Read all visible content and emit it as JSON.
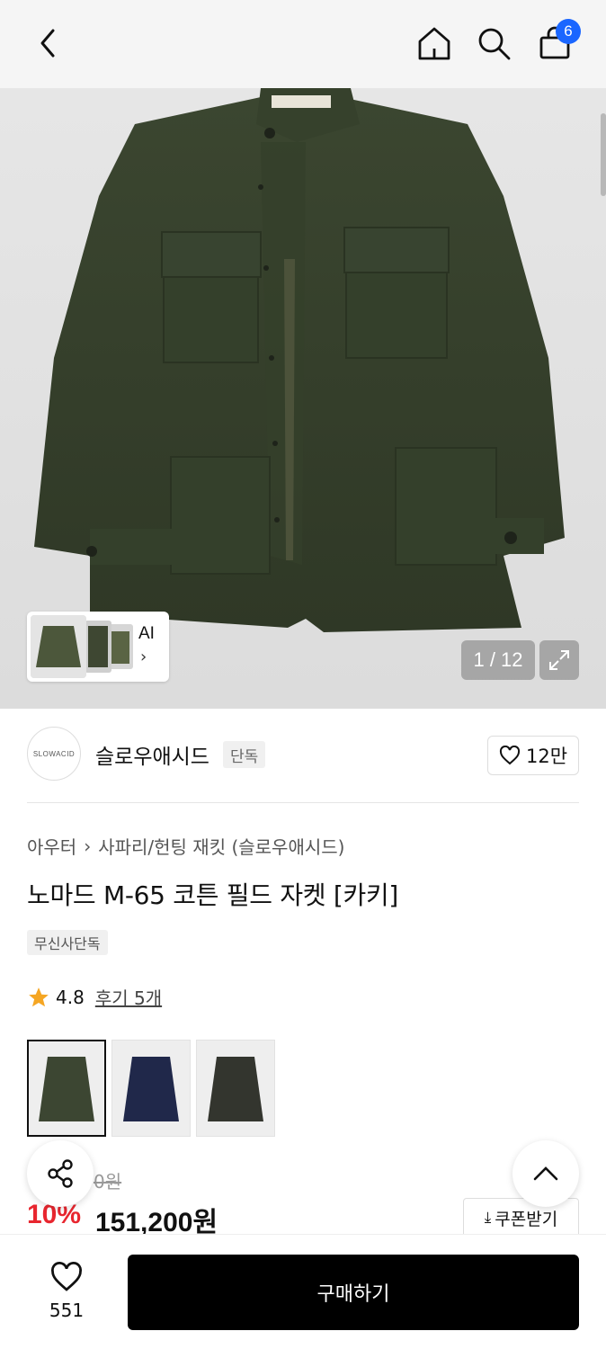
{
  "header": {
    "back_icon": "chevron-left-icon",
    "home_icon": "home-icon",
    "search_icon": "search-icon",
    "cart_icon": "shopping-bag-icon",
    "cart_count": "6"
  },
  "gallery": {
    "ai_label": "AI",
    "counter": "1 / 12",
    "expand_icon": "expand-icon"
  },
  "brand": {
    "logo_text": "SLOWACID",
    "name": "슬로우애시드",
    "tag": "단독",
    "likes": "12만"
  },
  "product": {
    "breadcrumb": [
      "아우터",
      "사파리/헌팅 재킷 (슬로우애시드)"
    ],
    "title": "노마드 M-65 코튼 필드 자켓 [카키]",
    "exclusive_tag": "무신사단독",
    "rating": "4.8",
    "reviews": "후기 5개",
    "original_price": "0원",
    "discount": "10%",
    "price": "151,200원",
    "coupon": "쿠폰받기"
  },
  "colors": {
    "khaki": "#3c4632",
    "navy": "#20284a",
    "charcoal": "#33352e"
  },
  "bottom": {
    "wish_count": "551",
    "buy_label": "구매하기"
  }
}
